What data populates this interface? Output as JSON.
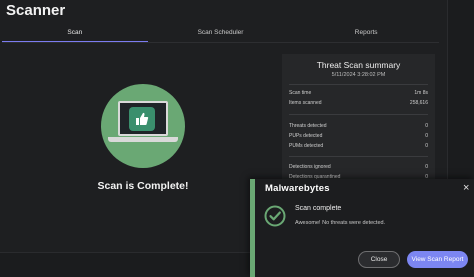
{
  "window": {
    "title": "Scanner"
  },
  "tabs": [
    {
      "label": "Scan",
      "active": true
    },
    {
      "label": "Scan Scheduler",
      "active": false
    },
    {
      "label": "Reports",
      "active": false
    }
  ],
  "hero": {
    "status_text": "Scan is Complete!",
    "icon": "thumbs-up-laptop-icon"
  },
  "summary": {
    "title": "Threat Scan summary",
    "date": "5/11/2024 3:28:02 PM",
    "rows": [
      {
        "label": "Scan time",
        "value": "1m 8s"
      },
      {
        "label": "Items scanned",
        "value": "258,616"
      },
      {
        "label": "Threats detected",
        "value": "0"
      },
      {
        "label": "PUPs detected",
        "value": "0"
      },
      {
        "label": "PUMs detected",
        "value": "0"
      },
      {
        "label": "Detections ignored",
        "value": "0"
      },
      {
        "label": "Detections quarantined",
        "value": "0"
      }
    ]
  },
  "toast": {
    "brand": "Malwarebytes",
    "title": "Scan complete",
    "message": "Awesome! No threats were detected.",
    "close_label": "Close",
    "report_label": "View Scan Report",
    "close_icon": "×"
  },
  "colors": {
    "accent": "#7c86f2",
    "success": "#6aa874"
  }
}
